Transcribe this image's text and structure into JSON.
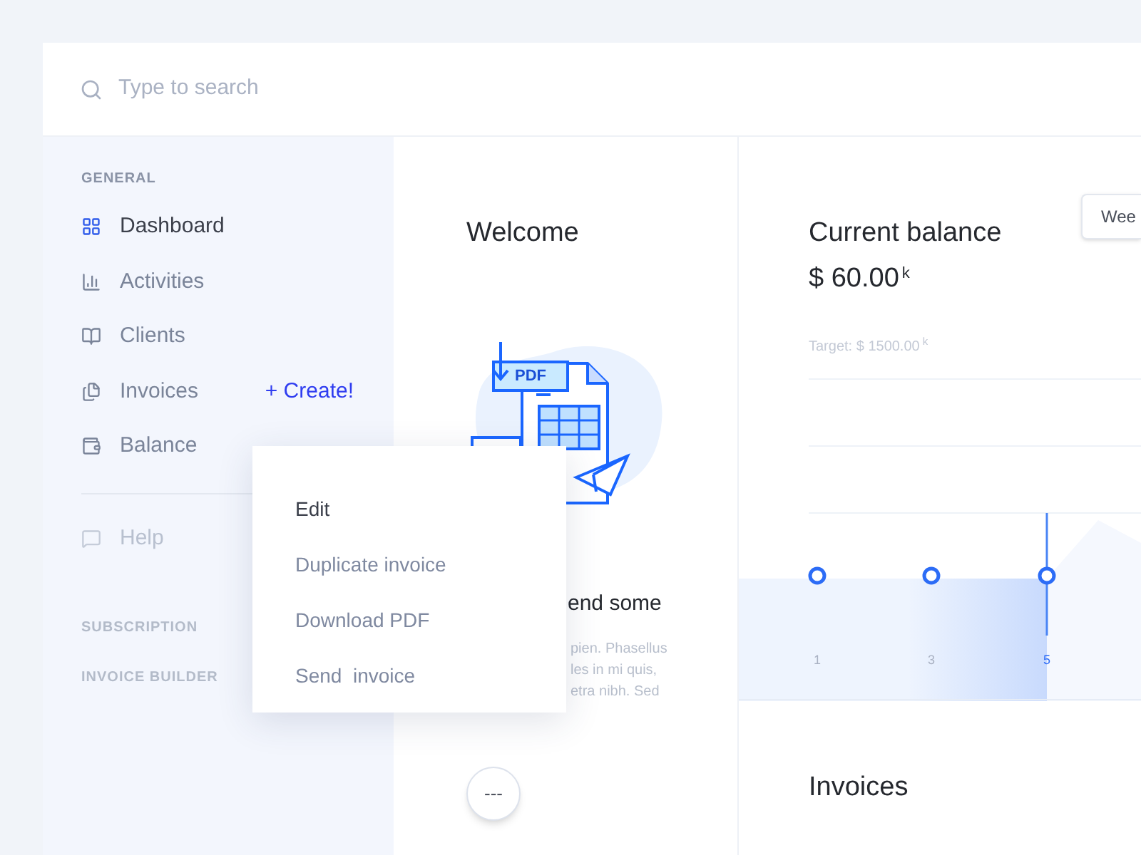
{
  "search": {
    "placeholder": "Type to search"
  },
  "sidebar": {
    "section": "GENERAL",
    "items": [
      {
        "label": "Dashboard",
        "selected": true,
        "disabled": false
      },
      {
        "label": "Activities",
        "selected": false,
        "disabled": false
      },
      {
        "label": "Clients",
        "selected": false,
        "disabled": false
      },
      {
        "label": "Invoices",
        "selected": false,
        "disabled": false,
        "action": "+ Create!"
      },
      {
        "label": "Balance",
        "selected": false,
        "disabled": false
      },
      {
        "label": "Help",
        "selected": false,
        "disabled": true
      }
    ],
    "links": [
      "SUBSCRIPTION",
      "INVOICE BUILDER"
    ]
  },
  "welcome": {
    "title": "Welcome",
    "pdf_label": "PDF",
    "heading": "end some",
    "lines": [
      "pien. Phasellus",
      "les in mi quis,",
      "etra nibh. Sed"
    ],
    "more_button": "---"
  },
  "context_menu": [
    "Edit",
    "Duplicate invoice",
    "Download PDF",
    "Send  invoice"
  ],
  "balance": {
    "title": "Current balance",
    "amount": "$ 60.00",
    "amount_unit": "k",
    "target": "Target: $ 1500.00",
    "target_unit": "k",
    "period_button": "Wee",
    "points": [
      {
        "label": "1",
        "selected": false
      },
      {
        "label": "3",
        "selected": false
      },
      {
        "label": "5",
        "selected": true
      }
    ]
  },
  "invoices": {
    "title": "Invoices"
  }
}
